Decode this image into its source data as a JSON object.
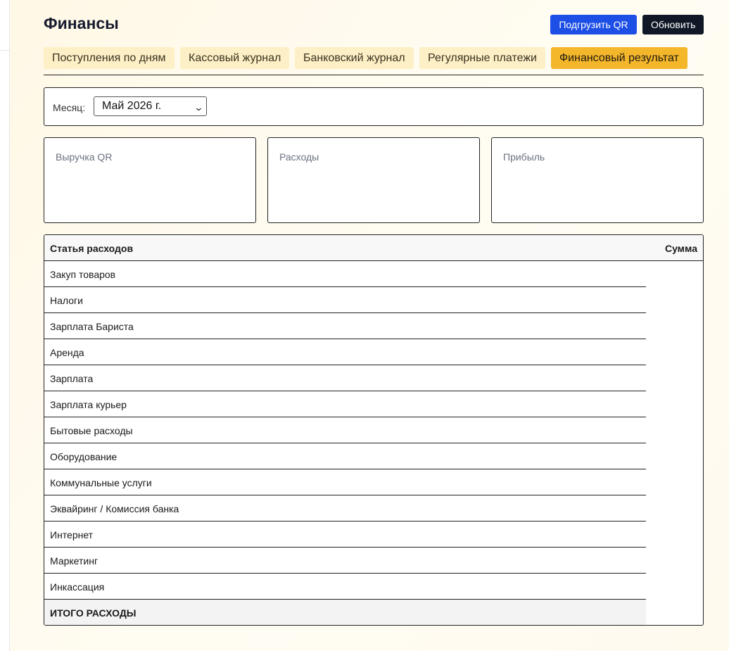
{
  "header": {
    "title": "Финансы",
    "upload_qr_label": "Подгрузить QR",
    "refresh_label": "Обновить"
  },
  "tabs": [
    {
      "label": "Поступления по дням",
      "active": false
    },
    {
      "label": "Кассовый журнал",
      "active": false
    },
    {
      "label": "Банковский журнал",
      "active": false
    },
    {
      "label": "Регулярные платежи",
      "active": false
    },
    {
      "label": "Финансовый результат",
      "active": true
    }
  ],
  "filter": {
    "month_label": "Месяц:",
    "month_value": "Май 2026 г."
  },
  "cards": [
    {
      "label": "Выручка QR"
    },
    {
      "label": "Расходы"
    },
    {
      "label": "Прибыль"
    }
  ],
  "table": {
    "columns": [
      "Статья расходов",
      "Сумма"
    ],
    "rows": [
      "Закуп товаров",
      "Налоги",
      "Зарплата Бариста",
      "Аренда",
      "Зарплата",
      "Зарплата курьер",
      "Бытовые расходы",
      "Оборудование",
      "Коммунальные услуги",
      "Эквайринг / Комиссия банка",
      "Интернет",
      "Маркетинг",
      "Инкассация"
    ],
    "total_label": "ИТОГО РАСХОДЫ"
  },
  "colors": {
    "primary_button": "#1d4ee6",
    "dark_button": "#101827",
    "tab_bg": "#fdf0c6",
    "tab_active": "#f4b62a",
    "page_bg": "#fff8e6"
  }
}
